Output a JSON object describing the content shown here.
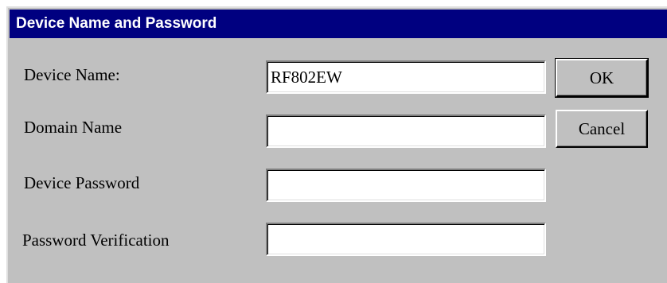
{
  "window": {
    "title": "Device Name and Password"
  },
  "form": {
    "device_name_label": "Device Name:",
    "device_name_value": "RF802EW",
    "domain_name_label": "Domain Name",
    "domain_name_value": "",
    "device_password_label": "Device Password",
    "device_password_value": "",
    "password_verification_label": "Password Verification",
    "password_verification_value": ""
  },
  "buttons": {
    "ok_label": "OK",
    "cancel_label": "Cancel"
  },
  "colors": {
    "titlebar": "#000080",
    "dialog_background": "#c0c0c0"
  }
}
